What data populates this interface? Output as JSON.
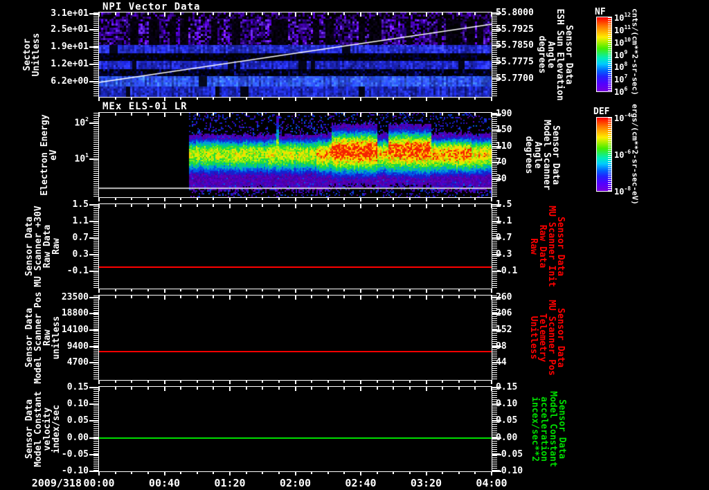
{
  "figure": {
    "bg": "#000000",
    "fg": "#ffffff",
    "accent_red": "#ff0000",
    "accent_green": "#00dd00",
    "date_label": "2009/318",
    "x_tick_labels": [
      "00:00",
      "00:40",
      "01:20",
      "02:00",
      "02:40",
      "03:20",
      "04:00"
    ]
  },
  "chart_data": [
    {
      "type": "heatmap",
      "title": "NPI Vector Data",
      "ylabel_lines": [
        "Sector",
        "Unitless"
      ],
      "yticks": [
        {
          "label": "3.1e+01",
          "frac": 0.016
        },
        {
          "label": "2.5e+01",
          "frac": 0.205
        },
        {
          "label": "1.9e+01",
          "frac": 0.41
        },
        {
          "label": "1.2e+01",
          "frac": 0.615
        },
        {
          "label": "6.2e+00",
          "frac": 0.82
        }
      ],
      "right_axis": {
        "color": "#ffffff",
        "label_lines": [
          "Sensor Data",
          "ESH Sun Elevation",
          "Angle",
          "degrees"
        ],
        "ticks": [
          {
            "label": "55.8000",
            "frac": 0.008
          },
          {
            "label": "55.7925",
            "frac": 0.205
          },
          {
            "label": "55.7850",
            "frac": 0.393
          },
          {
            "label": "55.7775",
            "frac": 0.59
          },
          {
            "label": "55.7700",
            "frac": 0.787
          }
        ]
      },
      "overlay_line": {
        "color": "#ffffff",
        "points": [
          [
            0,
            0.828
          ],
          [
            1,
            0.139
          ]
        ],
        "meaning": "ESH Sun Elevation Angle rising from ~55.770 to ~55.794 degrees over 00:00-04:00"
      },
      "bands": [
        {
          "y0": 0.0,
          "y1": 0.08,
          "palette": [
            [
              0,
              0,
              0
            ],
            [
              0,
              0,
              0
            ],
            [
              0,
              0,
              0
            ],
            [
              45,
              0,
              120
            ],
            [
              70,
              0,
              170
            ]
          ],
          "stripeProb": 0
        },
        {
          "y0": 0.08,
          "y1": 0.385,
          "palette": [
            [
              80,
              0,
              200
            ],
            [
              60,
              0,
              160
            ],
            [
              40,
              0,
              120
            ],
            [
              100,
              40,
              230
            ],
            [
              20,
              0,
              80
            ],
            [
              0,
              0,
              0
            ],
            [
              0,
              0,
              0
            ]
          ],
          "stripeProb": 0.12
        },
        {
          "y0": 0.385,
          "y1": 0.48,
          "palette": [
            [
              40,
              50,
              220
            ],
            [
              30,
              40,
              200
            ],
            [
              50,
              60,
              235
            ],
            [
              25,
              30,
              180
            ]
          ],
          "stripeProb": 0.02
        },
        {
          "y0": 0.48,
          "y1": 0.57,
          "palette": [
            [
              0,
              0,
              0
            ],
            [
              0,
              0,
              0
            ],
            [
              0,
              0,
              0
            ],
            [
              0,
              0,
              40
            ],
            [
              0,
              0,
              70
            ]
          ],
          "stripeProb": 0
        },
        {
          "y0": 0.57,
          "y1": 0.67,
          "palette": [
            [
              35,
              45,
              215
            ],
            [
              28,
              38,
              195
            ],
            [
              45,
              55,
              230
            ],
            [
              22,
              28,
              170
            ]
          ],
          "stripeProb": 0.02
        },
        {
          "y0": 0.67,
          "y1": 0.75,
          "palette": [
            [
              0,
              0,
              0
            ],
            [
              0,
              0,
              0
            ],
            [
              0,
              0,
              60
            ],
            [
              10,
              15,
              120
            ],
            [
              0,
              0,
              30
            ]
          ],
          "stripeProb": 0
        },
        {
          "y0": 0.75,
          "y1": 0.88,
          "palette": [
            [
              50,
              80,
              245
            ],
            [
              40,
              95,
              250
            ],
            [
              60,
              110,
              255
            ],
            [
              35,
              60,
              230
            ],
            [
              45,
              75,
              240
            ]
          ],
          "stripeProb": 0.02
        },
        {
          "y0": 0.88,
          "y1": 1.0,
          "palette": [
            [
              30,
              45,
              205
            ],
            [
              25,
              35,
              185
            ],
            [
              40,
              55,
              225
            ],
            [
              20,
              30,
              160
            ]
          ],
          "stripeProb": 0.02
        }
      ],
      "colorbar": {
        "title": "NF",
        "tick_base": "10",
        "tick_exponents": [
          "12",
          "11",
          "10",
          "9",
          "8",
          "7",
          "6"
        ],
        "units": "cnts/(cm**2-sr-sec)"
      }
    },
    {
      "type": "heatmap",
      "title": "MEx ELS-01 LR",
      "ylabel_lines": [
        "Electron Energy",
        "eV"
      ],
      "yticks": [
        {
          "base": "10",
          "exp": "2",
          "frac": 0.123
        },
        {
          "base": "10",
          "exp": "1",
          "frac": 0.549
        }
      ],
      "right_axis": {
        "color": "#ffffff",
        "label_lines": [
          "Sensor Data",
          "Model Scanner",
          "Angle",
          "degrees"
        ],
        "ticks": [
          {
            "label": "190",
            "frac": 0.016
          },
          {
            "label": "150",
            "frac": 0.205
          },
          {
            "label": "110",
            "frac": 0.4
          },
          {
            "label": "70",
            "frac": 0.59
          },
          {
            "label": "30",
            "frac": 0.787
          }
        ]
      },
      "data_start_frac": 0.229,
      "overlay_line": {
        "color": "#ffffff",
        "points": [
          [
            0,
            0.893
          ],
          [
            1,
            0.893
          ]
        ],
        "meaning": "constant white overlay line near panel bottom"
      },
      "band": {
        "center_frac": 0.475,
        "segments": [
          [
            0.0,
            0.26,
            0.58
          ],
          [
            0.26,
            0.3,
            0.66
          ],
          [
            0.3,
            0.42,
            0.6
          ],
          [
            0.42,
            0.47,
            0.82
          ],
          [
            0.47,
            0.62,
            1.0
          ],
          [
            0.62,
            0.655,
            0.72
          ],
          [
            0.655,
            0.8,
            0.95
          ],
          [
            0.8,
            0.84,
            0.78
          ],
          [
            0.84,
            0.93,
            0.85
          ],
          [
            0.93,
            1.0,
            0.7
          ]
        ],
        "spike_frac": 0.29
      },
      "colorbar": {
        "title": "DEF",
        "tick_base": "10",
        "tick_exponents": [
          "-4",
          "-6",
          "-8"
        ],
        "units": "ergs/(cm**2-sr-sec-eV)"
      }
    },
    {
      "type": "line",
      "ylabel_lines": [
        "Sensor Data",
        "MU Scanner +30V",
        "Raw Data",
        "Raw"
      ],
      "yticks": [
        {
          "label": "1.5",
          "frac": 0.008
        },
        {
          "label": "1.1",
          "frac": 0.205
        },
        {
          "label": "0.7",
          "frac": 0.402
        },
        {
          "label": "0.3",
          "frac": 0.598
        },
        {
          "label": "-0.1",
          "frac": 0.795
        }
      ],
      "right_axis": {
        "color": "#ff0000",
        "label_lines": [
          "Sensor Data",
          "MU Scanner Init",
          "Raw Data",
          "Raw"
        ],
        "ticks": [
          {
            "label": "1.5",
            "frac": 0.008
          },
          {
            "label": "1.1",
            "frac": 0.205
          },
          {
            "label": "0.7",
            "frac": 0.402
          },
          {
            "label": "0.3",
            "frac": 0.598
          },
          {
            "label": "-0.1",
            "frac": 0.795
          }
        ]
      },
      "line": {
        "color": "#ff0000",
        "value": 0.0,
        "frac": 0.745
      }
    },
    {
      "type": "line",
      "ylabel_lines": [
        "Sensor Data",
        "Model Scanner Pos",
        "Raw",
        "unitless"
      ],
      "yticks": [
        {
          "label": "23500",
          "frac": 0.025
        },
        {
          "label": "18800",
          "frac": 0.213
        },
        {
          "label": "14100",
          "frac": 0.41
        },
        {
          "label": "9400",
          "frac": 0.607
        },
        {
          "label": "4700",
          "frac": 0.795
        }
      ],
      "right_axis": {
        "color": "#ff0000",
        "label_lines": [
          "Sensor Data",
          "MU Scanner Pos",
          "Telemetry",
          "Unitless"
        ],
        "ticks": [
          {
            "label": "260",
            "frac": 0.025
          },
          {
            "label": "206",
            "frac": 0.213
          },
          {
            "label": "152",
            "frac": 0.41
          },
          {
            "label": "98",
            "frac": 0.607
          },
          {
            "label": "44",
            "frac": 0.795
          }
        ]
      },
      "line": {
        "color": "#ff0000",
        "value": 8000,
        "frac": 0.664
      }
    },
    {
      "type": "line",
      "ylabel_lines": [
        "Sensor Data",
        "Model Constant",
        "velocity",
        "index/sec"
      ],
      "yticks": [
        {
          "label": "0.15",
          "frac": 0.008
        },
        {
          "label": "0.10",
          "frac": 0.205
        },
        {
          "label": "0.05",
          "frac": 0.402
        },
        {
          "label": "0.00",
          "frac": 0.607
        },
        {
          "label": "-0.05",
          "frac": 0.803
        },
        {
          "label": "-0.10",
          "frac": 1.0
        }
      ],
      "right_axis": {
        "color": "#00dd00",
        "label_lines": [
          "Sensor Data",
          "Model Constant",
          "acceleration",
          "incex/sec**2"
        ],
        "ticks": [
          {
            "label": "0.15",
            "frac": 0.008
          },
          {
            "label": "0.10",
            "frac": 0.205
          },
          {
            "label": "0.05",
            "frac": 0.402
          },
          {
            "label": "0.00",
            "frac": 0.607
          },
          {
            "label": "-0.05",
            "frac": 0.803
          },
          {
            "label": "-0.10",
            "frac": 1.0
          }
        ]
      },
      "line": {
        "color": "#00dd00",
        "value": 0.0,
        "frac": 0.607
      }
    }
  ]
}
